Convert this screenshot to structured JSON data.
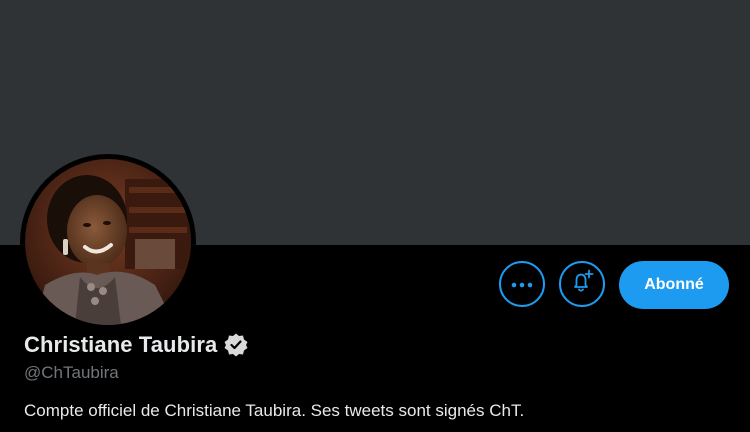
{
  "profile": {
    "display_name": "Christiane Taubira",
    "handle": "@ChTaubira",
    "bio": "Compte officiel de Christiane Taubira. Ses tweets sont signés ChT.",
    "verified": true
  },
  "actions": {
    "more_icon": "more-horizontal-icon",
    "notify_icon": "bell-plus-icon",
    "follow_label": "Abonné"
  },
  "colors": {
    "accent": "#1d9bf0",
    "banner": "#2f3336",
    "background": "#000000",
    "text_primary": "#e7e9ea",
    "text_secondary": "#71767b"
  }
}
